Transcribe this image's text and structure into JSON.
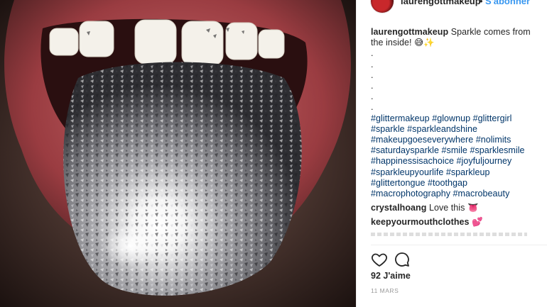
{
  "post": {
    "username": "laurengottmakeup",
    "header_separator": "•",
    "follow_label": "S'abonner",
    "caption_text": "Sparkle comes from the inside!",
    "caption_emoji": "😅✨",
    "caption_dots": [
      ".",
      ".",
      ".",
      ".",
      ".",
      "."
    ],
    "hashtag_lines": [
      "#glittermakeup #glownup #glittergirl",
      "#sparkle #sparkleandshine",
      "#makeupgoeseverywhere #nolimits",
      "#saturdaysparkle #smile #sparklesmile",
      "#happinessisachoice #joyfuljourney",
      "#sparkleupyourlife #sparkleup",
      "#glittertongue #toothgap",
      "#macrophotography #macrobeauty"
    ],
    "comments": [
      {
        "user": "crystalhoang",
        "text": "Love this",
        "emoji": "👅"
      },
      {
        "user": "keepyourmouthclothes",
        "text": "",
        "emoji": "💕"
      }
    ],
    "likes_label": "92 J'aime",
    "date_label": "11 MARS"
  },
  "icons": {
    "like": "heart-icon",
    "comment": "comment-bubble-icon",
    "avatar": "profile-avatar"
  },
  "colors": {
    "link_blue": "#3897f0",
    "hashtag": "#003569",
    "text": "#262626",
    "muted": "#999999"
  }
}
